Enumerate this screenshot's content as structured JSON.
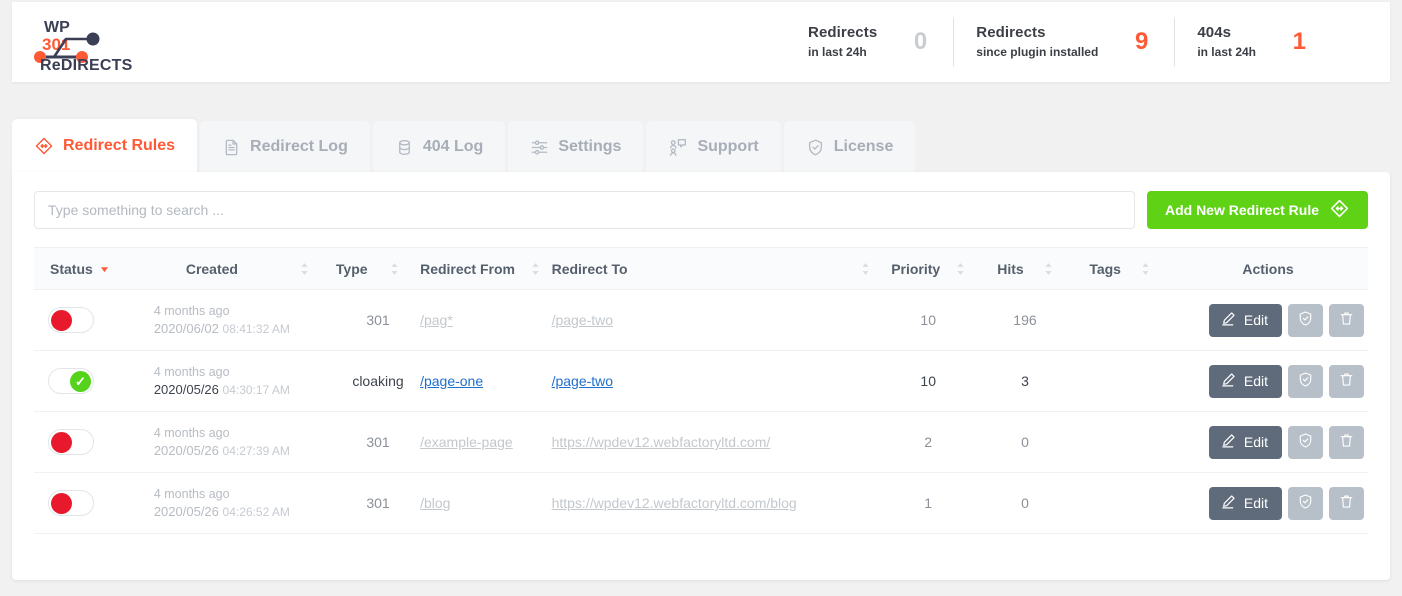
{
  "brand": {
    "line1": "WP",
    "line2": "301",
    "line3": "ReDIRECTS",
    "accent": "#ff5a36",
    "dark": "#3b3f55"
  },
  "header": {
    "stats": [
      {
        "title": "Redirects",
        "sub": "in last 24h",
        "value": "0",
        "value_color": "#c9cdd2"
      },
      {
        "title": "Redirects",
        "sub": "since plugin installed",
        "value": "9",
        "value_color": "#ff5a36"
      },
      {
        "title": "404s",
        "sub": "in last 24h",
        "value": "1",
        "value_color": "#ff5a36"
      }
    ]
  },
  "tabs": [
    {
      "label": "Redirect Rules",
      "icon": "diamond-arrows-icon",
      "active": true
    },
    {
      "label": "Redirect Log",
      "icon": "document-icon",
      "active": false
    },
    {
      "label": "404 Log",
      "icon": "database-icon",
      "active": false
    },
    {
      "label": "Settings",
      "icon": "sliders-icon",
      "active": false
    },
    {
      "label": "Support",
      "icon": "support-people-icon",
      "active": false
    },
    {
      "label": "License",
      "icon": "shield-check-icon",
      "active": false
    }
  ],
  "toolbar": {
    "search_placeholder": "Type something to search ...",
    "search_value": "",
    "add_label": "Add New Redirect Rule",
    "add_color": "#5fd216"
  },
  "table": {
    "columns": [
      {
        "label": "Status",
        "sortable": true,
        "sort": "desc"
      },
      {
        "label": "Created",
        "sortable": true,
        "sort": "none"
      },
      {
        "label": "Type",
        "sortable": true,
        "sort": "none"
      },
      {
        "label": "Redirect From",
        "sortable": true,
        "sort": "none"
      },
      {
        "label": "Redirect To",
        "sortable": true,
        "sort": "none"
      },
      {
        "label": "Priority",
        "sortable": true,
        "sort": "none"
      },
      {
        "label": "Hits",
        "sortable": true,
        "sort": "none"
      },
      {
        "label": "Tags",
        "sortable": true,
        "sort": "none"
      },
      {
        "label": "Actions",
        "sortable": false,
        "sort": "none"
      }
    ],
    "rows": [
      {
        "enabled": false,
        "ago": "4 months ago",
        "date": "2020/06/02",
        "time": "08:41:32 AM",
        "type": "301",
        "from": "/pag*",
        "to": "/page-two",
        "priority": "10",
        "hits": "196",
        "tags": "",
        "edit_label": "Edit"
      },
      {
        "enabled": true,
        "ago": "4 months ago",
        "date": "2020/05/26",
        "time": "04:30:17 AM",
        "type": "cloaking",
        "from": "/page-one",
        "to": "/page-two",
        "priority": "10",
        "hits": "3",
        "tags": "",
        "edit_label": "Edit"
      },
      {
        "enabled": false,
        "ago": "4 months ago",
        "date": "2020/05/26",
        "time": "04:27:39 AM",
        "type": "301",
        "from": "/example-page",
        "to": "https://wpdev12.webfactoryltd.com/",
        "priority": "2",
        "hits": "0",
        "tags": "",
        "edit_label": "Edit"
      },
      {
        "enabled": false,
        "ago": "4 months ago",
        "date": "2020/05/26",
        "time": "04:26:52 AM",
        "type": "301",
        "from": "/blog",
        "to": "https://wpdev12.webfactoryltd.com/blog",
        "priority": "1",
        "hits": "0",
        "tags": "",
        "edit_label": "Edit"
      }
    ]
  }
}
